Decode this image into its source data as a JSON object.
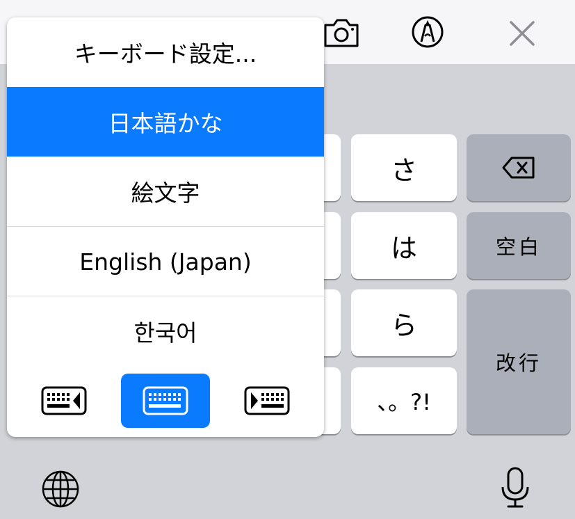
{
  "toolbar": {
    "icons": [
      "camera-icon",
      "markup-pen-icon",
      "close-icon"
    ]
  },
  "keys": {
    "sa": "さ",
    "ha": "は",
    "ra": "ら",
    "punct": "、。?!",
    "space": "空白",
    "return": "改行"
  },
  "popup": {
    "settings": "キーボード設定...",
    "items": [
      "日本語かな",
      "絵文字",
      "English (Japan)",
      "한국어"
    ],
    "selected_index": 0,
    "modes": [
      "keyboard-left-icon",
      "keyboard-full-icon",
      "keyboard-right-icon"
    ]
  },
  "colors": {
    "accent": "#0a7afe",
    "function_key": "#abafb9",
    "keyboard_bg": "#d2d3d8"
  },
  "bottom": {
    "icons": [
      "globe-icon",
      "microphone-icon"
    ]
  }
}
